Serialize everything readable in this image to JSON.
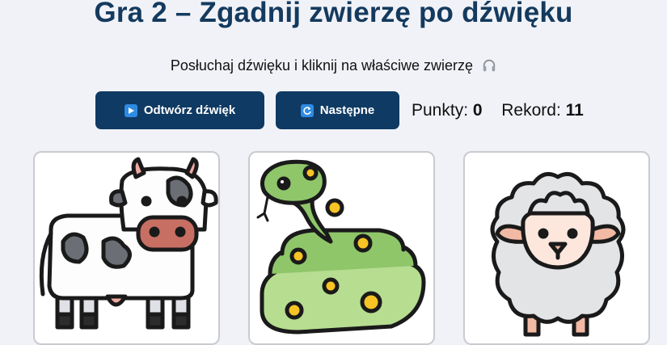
{
  "game": {
    "title": "Gra 2 – Zgadnij zwierzę po dźwięku",
    "instruction": "Posłuchaj dźwięku i kliknij na właściwe zwierzę",
    "instruction_icon": "headphones-icon"
  },
  "controls": {
    "play_label": "Odtwórz dźwięk",
    "play_icon": "play-icon",
    "next_label": "Następne",
    "next_icon": "refresh-icon",
    "points_label": "Punkty:",
    "points_value": "0",
    "record_label": "Rekord:",
    "record_value": "11"
  },
  "cards": [
    {
      "animal": "cow-icon"
    },
    {
      "animal": "snake-icon"
    },
    {
      "animal": "sheep-icon"
    }
  ],
  "colors": {
    "title": "#143a5e",
    "button": "#0f3a63",
    "background": "#f1f2f7"
  }
}
